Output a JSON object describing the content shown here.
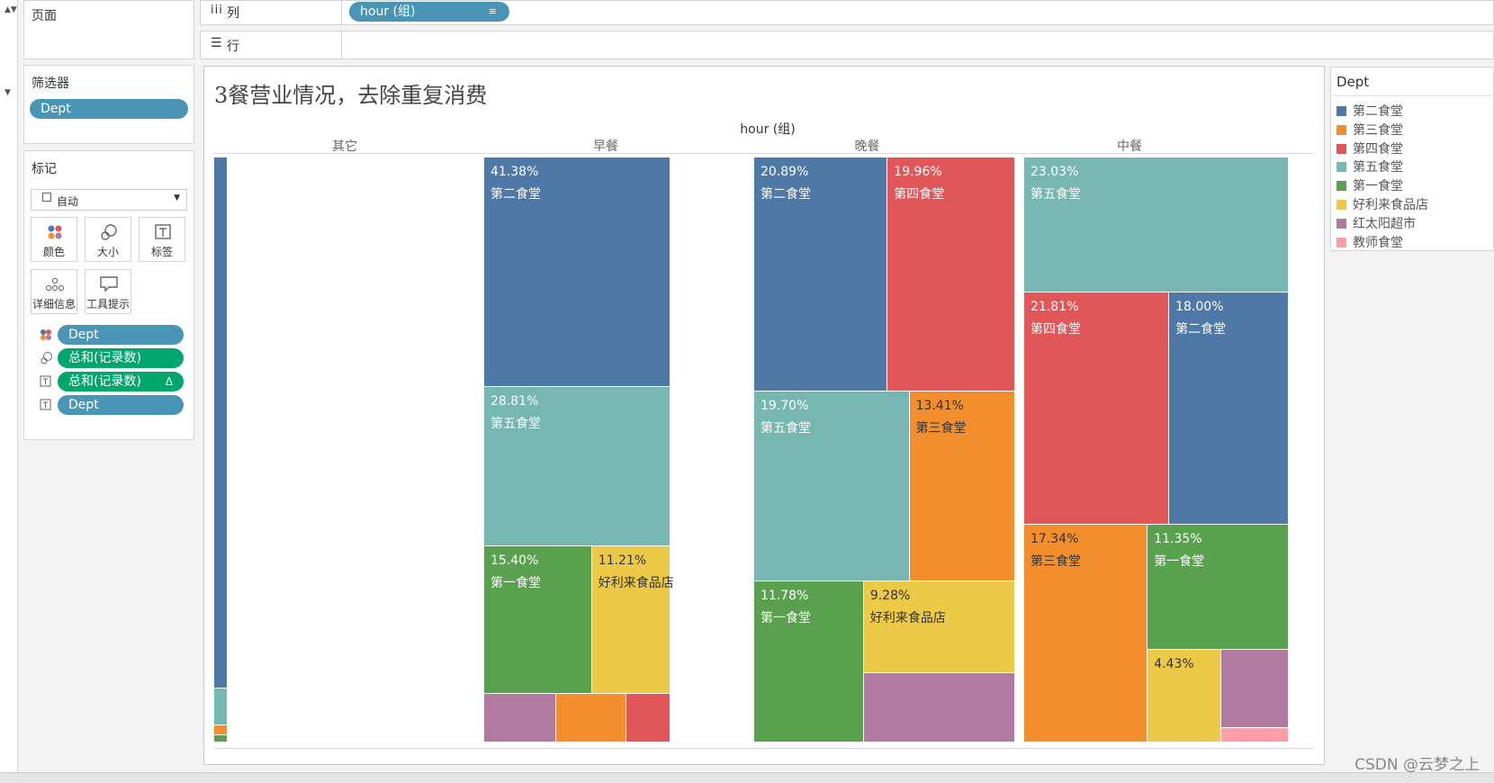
{
  "shelves": {
    "columns_label": "列",
    "columns_pill": "hour (组)",
    "rows_label": "行"
  },
  "panels": {
    "pages_title": "页面",
    "filters_title": "筛选器",
    "filters": [
      "Dept"
    ],
    "marks_title": "标记",
    "mark_type": "自动",
    "cards": [
      "颜色",
      "大小",
      "标签",
      "详细信息",
      "工具提示"
    ],
    "mark_fields": [
      {
        "label": "Dept",
        "kind": "dimension",
        "icon": "color-icon"
      },
      {
        "label": "总和(记录数)",
        "kind": "measure",
        "icon": "size-icon"
      },
      {
        "label": "总和(记录数)",
        "kind": "measure",
        "icon": "label-icon"
      },
      {
        "label": "Dept",
        "kind": "dimension",
        "icon": "label-icon"
      }
    ],
    "delta_symbol": "Δ"
  },
  "legend": {
    "title": "Dept",
    "items": [
      {
        "name": "第二食堂",
        "color": "#4e79a7"
      },
      {
        "name": "第三食堂",
        "color": "#f28e2b"
      },
      {
        "name": "第四食堂",
        "color": "#e15759"
      },
      {
        "name": "第五食堂",
        "color": "#76b7b2"
      },
      {
        "name": "第一食堂",
        "color": "#59a14f"
      },
      {
        "name": "好利来食品店",
        "color": "#edc948"
      },
      {
        "name": "红太阳超市",
        "color": "#b07aa1"
      },
      {
        "name": "教师食堂",
        "color": "#ff9da7"
      }
    ]
  },
  "chart_data": {
    "type": "treemap",
    "title": "3餐营业情况，去除重复消费",
    "column_axis_title": "hour (组)",
    "panels": [
      {
        "name": "其它",
        "cells": [
          {
            "dept": "第二食堂",
            "share": 0.913
          },
          {
            "dept": "第五食堂",
            "share": 0.063
          },
          {
            "dept": "第三食堂",
            "share": 0.018
          },
          {
            "dept": "第一食堂",
            "share": 0.012
          }
        ]
      },
      {
        "name": "早餐",
        "cells": [
          {
            "dept": "第二食堂",
            "pct": "41.38%",
            "share": 0.4138
          },
          {
            "dept": "第五食堂",
            "pct": "28.81%",
            "share": 0.2881
          },
          {
            "dept": "第一食堂",
            "pct": "15.40%",
            "share": 0.154
          },
          {
            "dept": "好利来食品店",
            "pct": "11.21%",
            "share": 0.1121
          },
          {
            "dept": "红太阳超市",
            "share": 0.034
          },
          {
            "dept": "第三食堂",
            "share": 0.033
          },
          {
            "dept": "第四食堂",
            "share": 0.021
          }
        ]
      },
      {
        "name": "晚餐",
        "cells": [
          {
            "dept": "第二食堂",
            "pct": "20.89%",
            "share": 0.2089
          },
          {
            "dept": "第四食堂",
            "pct": "19.96%",
            "share": 0.1996
          },
          {
            "dept": "第五食堂",
            "pct": "19.70%",
            "share": 0.197
          },
          {
            "dept": "第三食堂",
            "pct": "13.41%",
            "share": 0.1341
          },
          {
            "dept": "第一食堂",
            "pct": "11.78%",
            "share": 0.1178
          },
          {
            "dept": "好利来食品店",
            "pct": "9.28%",
            "share": 0.0928
          },
          {
            "dept": "红太阳超市",
            "share": 0.0698
          }
        ]
      },
      {
        "name": "中餐",
        "cells": [
          {
            "dept": "第五食堂",
            "pct": "23.03%",
            "share": 0.2303
          },
          {
            "dept": "第四食堂",
            "pct": "21.81%",
            "share": 0.2181
          },
          {
            "dept": "第二食堂",
            "pct": "18.00%",
            "share": 0.18
          },
          {
            "dept": "第三食堂",
            "pct": "17.34%",
            "share": 0.1734
          },
          {
            "dept": "第一食堂",
            "pct": "11.35%",
            "share": 0.1135
          },
          {
            "dept": "好利来食品店",
            "pct": "4.43%",
            "share": 0.0443
          },
          {
            "dept": "红太阳超市",
            "share": 0.034
          },
          {
            "dept": "教师食堂",
            "share": 0.0064
          }
        ]
      }
    ]
  },
  "watermark": "CSDN @云梦之上"
}
